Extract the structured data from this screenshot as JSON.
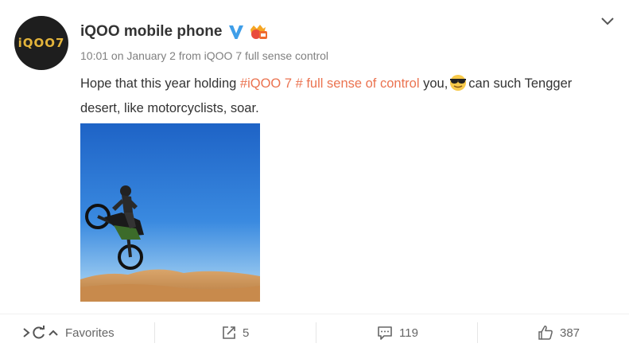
{
  "post": {
    "author": {
      "name": "iQOO mobile phone",
      "avatar_text": "iQOO7",
      "verified_icon": "verified-v-icon",
      "badge_icon": "member-badge-icon"
    },
    "meta": "10:01 on January 2 from iQOO 7 full sense control",
    "text": {
      "part1": "Hope that this year holding ",
      "hashtag": "#iQOO 7 # full sense of control",
      "part2": " you,",
      "emoji": "sunglasses-emoji",
      "part3": "can such Tengger desert, like motorcyclists, soar."
    },
    "image": {
      "description_icon": "motorcycle-desert-photo"
    }
  },
  "actions": {
    "favorites_label": "Favorites",
    "reposts": "5",
    "comments": "119",
    "likes": "387"
  },
  "colors": {
    "hashtag": "#eb7350",
    "verified": "#3f9ee8",
    "meta": "#808080"
  }
}
